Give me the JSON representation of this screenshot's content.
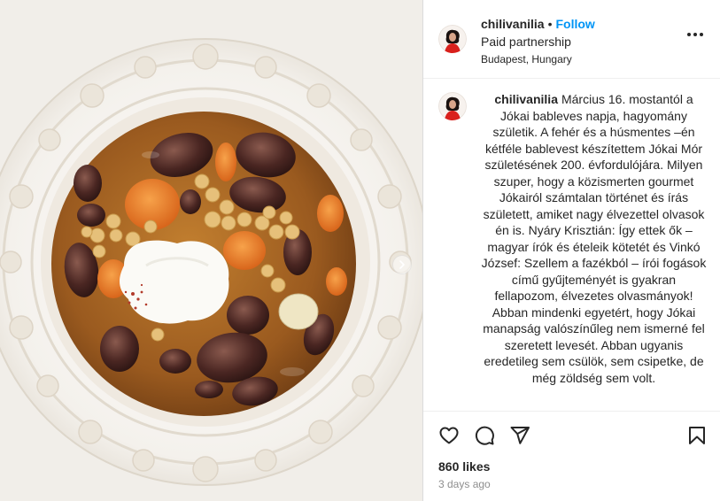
{
  "media": {
    "alt_icon": "soup-photo"
  },
  "post": {
    "username": "chilivanilia",
    "separator": "•",
    "follow_label": "Follow",
    "partnership_label": "Paid partnership",
    "location": "Budapest, Hungary",
    "more_icon": "more-horizontal-icon"
  },
  "caption": {
    "username": "chilivanilia",
    "text": "Március 16. mostantól a Jókai bableves napja, hagyomány születik. A fehér és a húsmentes –én kétféle bablevest készítettem Jókai Mór születésének 200. évfordulójára. Milyen szuper, hogy a közismerten gourmet Jókairól számtalan történet és írás született, amiket nagy élvezettel olvasok én is. Nyáry Krisztián: Így ettek ők – magyar írók és ételeik kötetét és Vinkó József: Szellem a fazékból – írói fogások című gyűjteményét is gyakran fellapozom, élvezetes olvasmányok! Abban mindenki egyetért, hogy Jókai manapság valószínűleg nem ismerné fel szeretett levesét. Abban ugyanis eredetileg sem csülök, sem csipetke, de még zöldség sem volt."
  },
  "actions": {
    "like_icon": "heart-icon",
    "comment_icon": "comment-icon",
    "share_icon": "share-icon",
    "save_icon": "bookmark-icon",
    "likes": "860 likes",
    "timestamp": "3 days ago"
  },
  "colors": {
    "link_blue": "#0095f6",
    "text": "#262626",
    "muted": "#8e8e8e",
    "border": "#dbdbdb"
  }
}
